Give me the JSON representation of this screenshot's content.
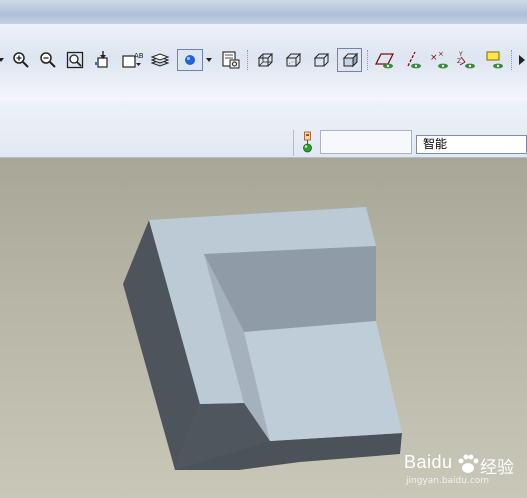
{
  "toolbar": {
    "buttons": [
      {
        "icon": "zoom-in-icon"
      },
      {
        "icon": "zoom-out-icon"
      },
      {
        "icon": "refit-icon"
      },
      {
        "icon": "reorient-icon"
      },
      {
        "icon": "saved-views-icon"
      },
      {
        "icon": "layers-icon"
      },
      {
        "icon": "appearance-icon",
        "pressed": true
      },
      {
        "icon": "repaint-icon"
      },
      {
        "icon": "wireframe-icon"
      },
      {
        "icon": "hidden-line-icon"
      },
      {
        "icon": "no-hidden-icon"
      },
      {
        "icon": "shading-icon",
        "pressed": true
      },
      {
        "icon": "datum-planes-icon"
      },
      {
        "icon": "datum-axes-icon"
      },
      {
        "icon": "datum-points-icon"
      },
      {
        "icon": "coordinate-systems-icon"
      },
      {
        "icon": "annotation-icon"
      }
    ]
  },
  "status": {
    "filter_value": "智能"
  },
  "watermark": {
    "brand": "Baidu",
    "brand_cn": "经验",
    "site": "jingyan.baidu.com"
  },
  "colors": {
    "viewport_top": "#a8a697",
    "viewport_bottom": "#c8c7b8",
    "model_top": "#bdcbd6",
    "model_wall": "#8e9ba7",
    "model_floor": "#bfcdd8",
    "model_dark": "#4e545b"
  }
}
